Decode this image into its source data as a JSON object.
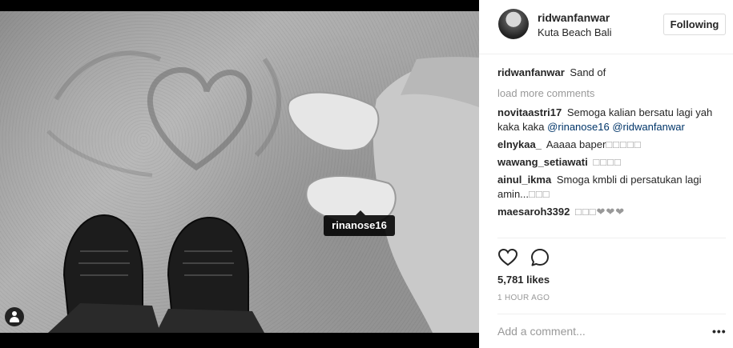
{
  "photo": {
    "tag_username": "rinanose16"
  },
  "header": {
    "username": "ridwanfanwar",
    "location": "Kuta Beach Bali",
    "follow_label": "Following"
  },
  "caption": {
    "username": "ridwanfanwar",
    "text": "Sand of"
  },
  "load_more_label": "load more comments",
  "comments": [
    {
      "username": "novitaastri17",
      "text": "Semoga kalian bersatu lagi yah kaka kaka",
      "mentions": [
        "@rinanose16",
        "@ridwanfanwar"
      ]
    },
    {
      "username": "elnykaa_",
      "text": "Aaaaa baper",
      "extra": "□□□□□"
    },
    {
      "username": "wawang_setiawati",
      "text": "",
      "extra": "□□□□"
    },
    {
      "username": "ainul_ikma",
      "text": "Smoga kmbli di persatukan lagi amin...",
      "extra": "□□□"
    },
    {
      "username": "maesaroh3392",
      "text": "",
      "extra": "□□□❤❤❤"
    }
  ],
  "actions": {
    "like_icon": "heart-icon",
    "comment_icon": "comment-icon"
  },
  "likes_text": "5,781 likes",
  "time_text": "1 HOUR AGO",
  "add_comment_placeholder": "Add a comment...",
  "more_label": "•••"
}
